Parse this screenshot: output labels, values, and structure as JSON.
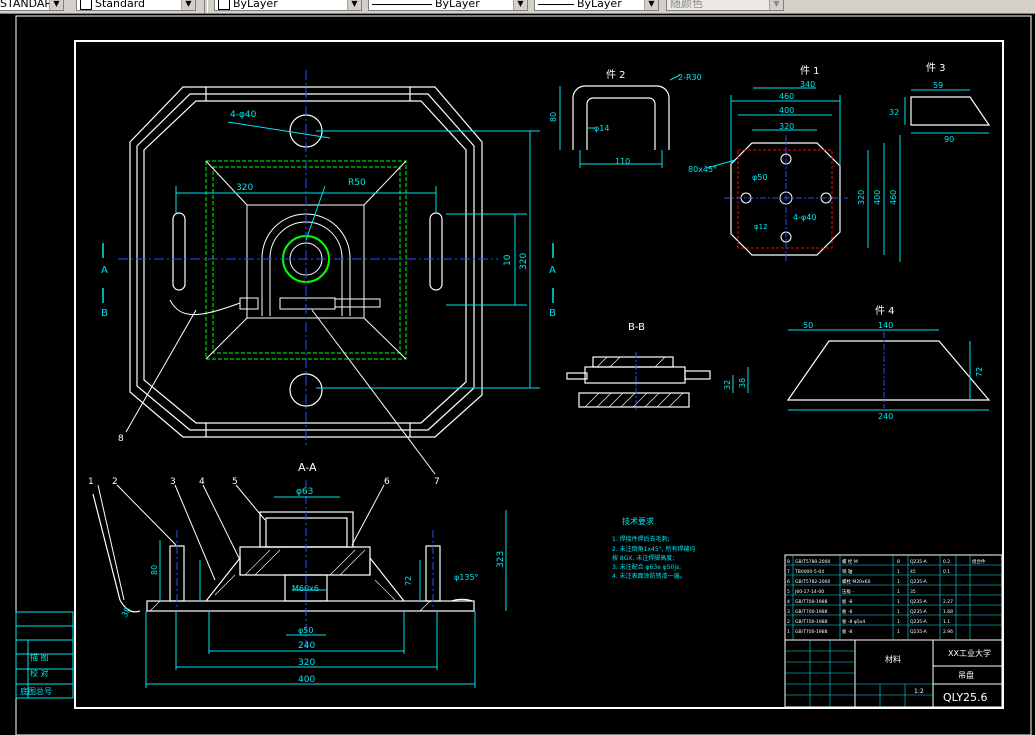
{
  "toolbar": {
    "text_style": "STANDARD",
    "dim_style": "Standard",
    "layer": "ByLayer",
    "linetype": "ByLayer",
    "lineweight": "ByLayer",
    "plotstyle": "随颜色"
  },
  "colors": {
    "cyan": "#00e5ee",
    "white": "#ffffff",
    "yellow": "#ffff00",
    "green": "#00ff00",
    "red": "#ff0000",
    "blue": "#2a4dff",
    "toolbar_bg": "#d4d0c8"
  },
  "drawing": {
    "plan_dims": {
      "d320": "320",
      "dR50": "R50",
      "d4phi40": "4-φ40",
      "d10": "10",
      "d320v": "320"
    },
    "section_labels": {
      "A_top": "A",
      "A_bot": "A",
      "B_top": "B",
      "B_bot": "B"
    },
    "balloons": [
      "1",
      "2",
      "3",
      "4",
      "5",
      "6",
      "7",
      "8"
    ],
    "aa": {
      "title": "A-A",
      "phi63": "φ63",
      "m60": "M60x6",
      "phi50": "φ50",
      "d240": "240",
      "d320": "320",
      "d400": "400",
      "d72": "72",
      "d323": "323",
      "d80": "80",
      "d135": "φ135°",
      "d38": "38"
    },
    "part2": {
      "title": "件 2",
      "r30": "2-R30",
      "d80": "80",
      "phi14": "φ14",
      "d110": "110"
    },
    "part1": {
      "title": "件 1",
      "d340": "340",
      "d460": "460",
      "d400": "400",
      "d320": "320",
      "chamfer": "80x45°",
      "phi50": "φ50",
      "phi40": "4-φ40",
      "d12": "φ12",
      "v320": "320",
      "v400": "400",
      "v460": "460"
    },
    "part3": {
      "title": "件 3",
      "d59": "59",
      "d32": "32",
      "d90": "90"
    },
    "part4": {
      "title": "件 4",
      "d50": "50",
      "d140": "140",
      "d72": "72",
      "d240": "240"
    },
    "bb": {
      "title": "B-B",
      "d32": "32",
      "d38": "38"
    },
    "notes": {
      "title": "技术要求",
      "lines": [
        "1. 焊接件焊后去毛刺;",
        "2. 未注倒角1x45°, 所有焊缝均",
        "   按 8GX, 未注焊脚高度;",
        "3. 未注配合 φ63e φ50js;",
        "4. 未注表面涂防锈漆一遍。"
      ]
    },
    "title_block": {
      "school": "XX工业大学",
      "name": "吊盘",
      "material": "材料",
      "scale": "1:2",
      "code": "QLY25.6",
      "bom": [
        [
          "8",
          "GB/T5780-2000",
          "螺 栓 M",
          "8",
          "Q235-A",
          "0.2",
          "",
          "组合件"
        ],
        [
          "7",
          "TB0000-5-04",
          "销 轴",
          "1",
          "45",
          "0.1",
          "",
          ""
        ],
        [
          "6",
          "GB/T5782-2000",
          "螺栓 M20x60",
          "1",
          "Q235-A",
          "",
          "",
          ""
        ],
        [
          "5",
          "J60-17-14-00",
          "压板 -",
          "1",
          "35",
          "",
          "",
          ""
        ],
        [
          "4",
          "GB/T700-1988",
          "板 -8",
          "1",
          "Q235-A",
          "2.27",
          "",
          ""
        ],
        [
          "3",
          "GB/T700-1988",
          "板 -8",
          "1",
          "Q235-A",
          "1.68",
          "",
          ""
        ],
        [
          "2",
          "GB/T700-1988",
          "板 -8 φ5x4",
          "1",
          "Q235-A",
          "1.1",
          "",
          ""
        ],
        [
          "1",
          "GB/T700-1988",
          "板 -8",
          "1",
          "Q235-A",
          "2.96",
          "",
          ""
        ]
      ],
      "left_labels": [
        "描 图",
        "校 对",
        "底图总号"
      ]
    }
  }
}
